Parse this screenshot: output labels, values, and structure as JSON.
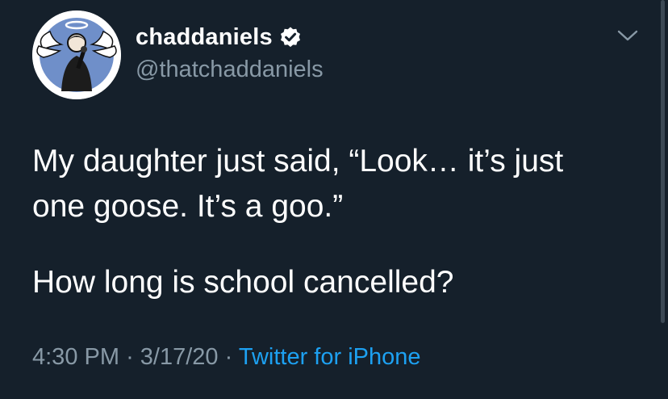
{
  "tweet": {
    "display_name": "chaddaniels",
    "handle": "@thatchaddaniels",
    "text_line1": "My daughter just said, “Look… it’s just",
    "text_line2": "one goose. It’s a goo.”",
    "text_line3": "How long is school cancelled?",
    "time": "4:30 PM",
    "date": "3/17/20",
    "separator": "·",
    "source": "Twitter for iPhone"
  },
  "icons": {
    "verified": "verified-badge-icon",
    "menu": "chevron-down-icon",
    "avatar": "profile-photo"
  },
  "colors": {
    "background": "#15202b",
    "text": "#ffffff",
    "secondary": "#8899a6",
    "link": "#1da1f2"
  }
}
